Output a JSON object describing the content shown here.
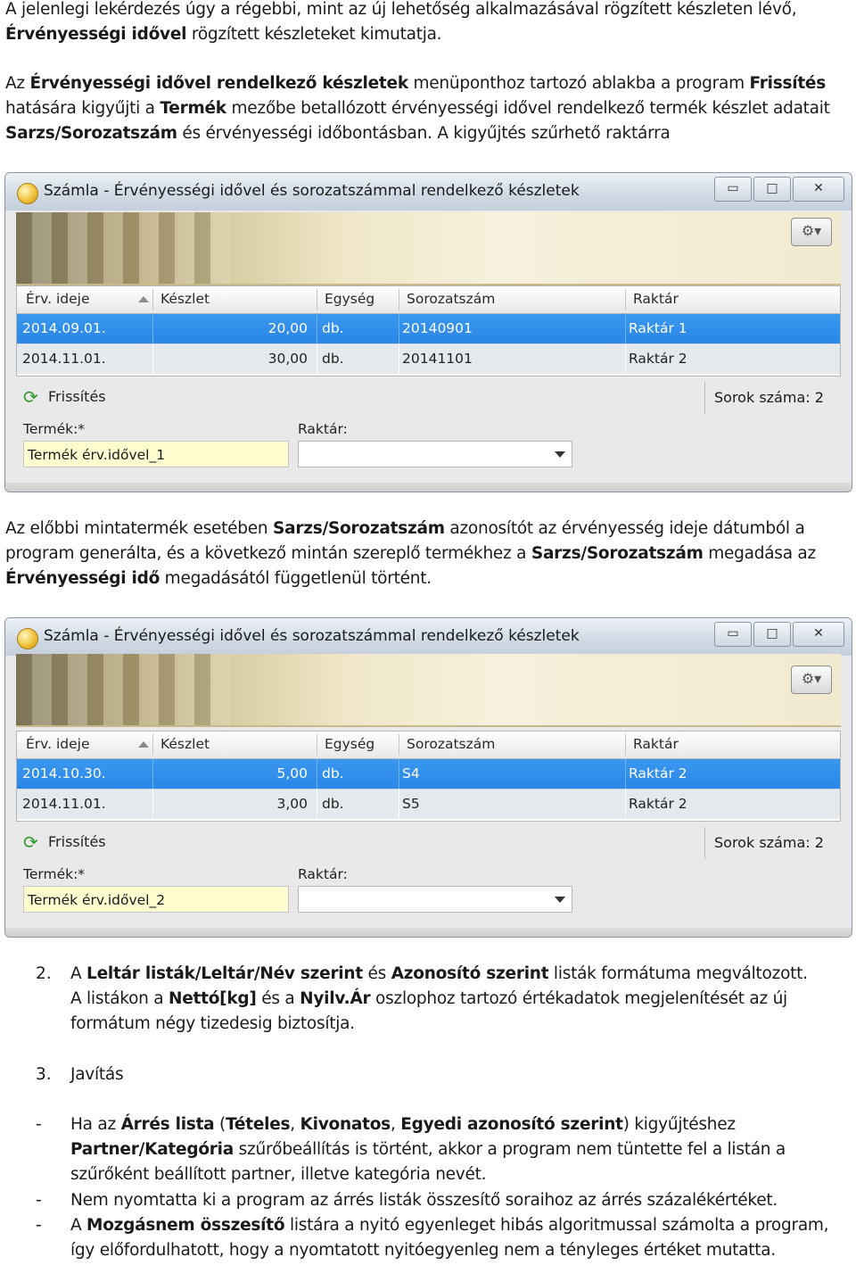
{
  "paragraph1": {
    "line1": "A jelenlegi lekérdezés úgy a régebbi, mint az új lehetőség alkalmazásával rögzített készleten lévő,",
    "line2_bold": "Érvényességi idővel",
    "line2_rest": " rögzített készleteket kimutatja."
  },
  "paragraph2": {
    "a": "Az ",
    "b": "Érvényességi idővel rendelkező készletek",
    "c": " menüponthoz tartozó ablakba a program ",
    "d": "Frissítés",
    "e": "hatására kigyűjti a ",
    "f": "Termék",
    "g": " mezőbe betallózott érvényességi idővel rendelkező termék készlet adatait",
    "h": "Sarzs/Sorozatszám",
    "i": " és érvényességi időbontásban. A kigyűjtés szűrhető raktárra"
  },
  "window_common": {
    "title": "Számla - Érvényességi idővel és sorozatszámmal rendelkező készletek",
    "minimize": "▭",
    "maximize": "□",
    "close": "✕",
    "columns": [
      "Érv. ideje",
      "Készlet",
      "Egység",
      "Sorozatszám",
      "Raktár"
    ],
    "refresh_label": "Frissítés",
    "product_label": "Termék:*",
    "warehouse_label": "Raktár:"
  },
  "window1": {
    "rows": [
      {
        "date": "2014.09.01.",
        "qty": "20,00",
        "unit": "db.",
        "serial": "20140901",
        "warehouse": "Raktár 1"
      },
      {
        "date": "2014.11.01.",
        "qty": "30,00",
        "unit": "db.",
        "serial": "20141101",
        "warehouse": "Raktár 2"
      }
    ],
    "rowcount": "Sorok száma:  2",
    "product_value": "Termék érv.idővel_1"
  },
  "paragraph3": {
    "a": "Az előbbi mintatermék esetében ",
    "b": "Sarzs/Sorozatszám",
    "c": " azonosítót az érvényesség ideje dátumból a",
    "d": "program generálta, és a következő mintán szereplő termékhez a ",
    "e": "Sarzs/Sorozatszám",
    "f": " megadása az",
    "g": "Érvényességi idő",
    "h": " megadásától függetlenül történt."
  },
  "window2": {
    "rows": [
      {
        "date": "2014.10.30.",
        "qty": "5,00",
        "unit": "db.",
        "serial": "S4",
        "warehouse": "Raktár 2"
      },
      {
        "date": "2014.11.01.",
        "qty": "3,00",
        "unit": "db.",
        "serial": "S5",
        "warehouse": "Raktár 2"
      }
    ],
    "rowcount": "Sorok száma:  2",
    "product_value": "Termék érv.idővel_2"
  },
  "item2": {
    "num": "2.",
    "a": "A ",
    "b": "Leltár listák/Leltár/Név szerint",
    "c": " és ",
    "d": "Azonosító szerint",
    "e": " listák formátuma megváltozott.",
    "f": "A listákon a ",
    "g": "Nettó[kg]",
    "h": " és a ",
    "i": "Nyilv.Ár",
    "j": " oszlophoz tartozó értékadatok megjelenítését az új",
    "k": "formátum négy tizedesig biztosítja."
  },
  "item3": {
    "num": "3.",
    "label": "Javítás"
  },
  "bullets": {
    "dash": "-",
    "b1": {
      "a": "Ha az ",
      "b": "Árrés lista",
      "c": " (",
      "d": "Tételes",
      "e": ", ",
      "f": "Kivonatos",
      "g": ", ",
      "h": "Egyedi azonosító szerint",
      "i": ") kigyűjtéshez",
      "j": "Partner/Kategória",
      "k": " szűrőbeállítás is történt, akkor a program nem tüntette fel a listán a",
      "l": "szűrőként beállított partner, illetve kategória nevét."
    },
    "b2": "Nem nyomtatta ki a program az árrés listák összesítő soraihoz az árrés százalékértéket.",
    "b3": {
      "a": "A ",
      "b": "Mozgásnem összesítő",
      "c": " listára a nyitó egyenleget hibás algoritmussal számolta a program,",
      "d": "így előfordulhatott, hogy a nyomtatott nyitóegyenleg nem a tényleges értéket mutatta."
    }
  }
}
